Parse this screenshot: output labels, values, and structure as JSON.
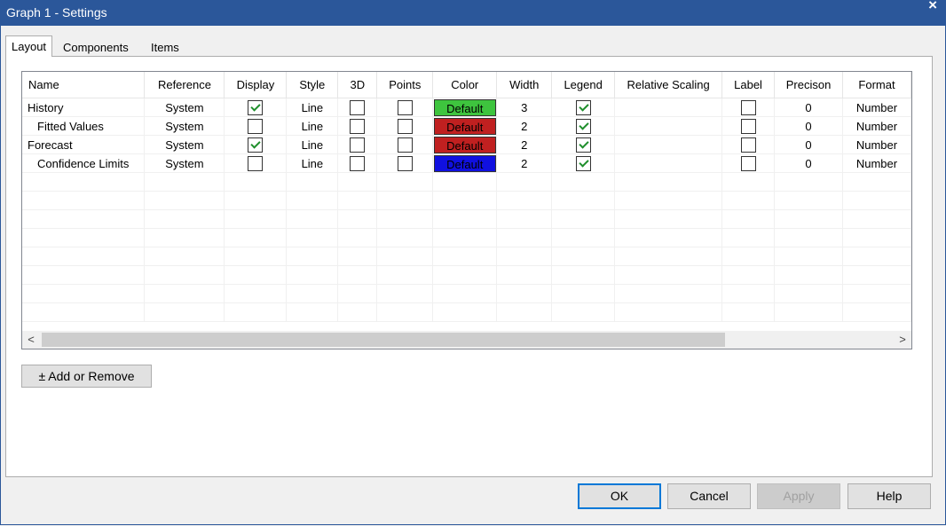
{
  "window": {
    "title": "Graph 1 - Settings",
    "close_glyph": "×"
  },
  "tabs": [
    {
      "label": "Layout",
      "active": true
    },
    {
      "label": "Components",
      "active": false
    },
    {
      "label": "Items",
      "active": false
    }
  ],
  "grid": {
    "columns": [
      "Name",
      "Reference",
      "Display",
      "Style",
      "3D",
      "Points",
      "Color",
      "Width",
      "Legend",
      "Relative Scaling",
      "Label",
      "Precison",
      "Format"
    ],
    "rows": [
      {
        "name": "History",
        "reference": "System",
        "display": true,
        "style": "Line",
        "three_d": false,
        "points": false,
        "color": {
          "label": "Default",
          "hex": "#3ec43e",
          "text": "#000000"
        },
        "width": "3",
        "legend": true,
        "relative_scaling": "",
        "label": false,
        "precision": "0",
        "format": "Number"
      },
      {
        "name": "Fitted Values",
        "indent": true,
        "reference": "System",
        "display": false,
        "style": "Line",
        "three_d": false,
        "points": false,
        "color": {
          "label": "Default",
          "hex": "#c02020",
          "text": "#000000"
        },
        "width": "2",
        "legend": true,
        "relative_scaling": "",
        "label": false,
        "precision": "0",
        "format": "Number"
      },
      {
        "name": "Forecast",
        "reference": "System",
        "display": true,
        "style": "Line",
        "three_d": false,
        "points": false,
        "color": {
          "label": "Default",
          "hex": "#c02020",
          "text": "#000000"
        },
        "width": "2",
        "legend": true,
        "relative_scaling": "",
        "label": false,
        "precision": "0",
        "format": "Number"
      },
      {
        "name": "Confidence Limits",
        "indent": true,
        "reference": "System",
        "display": false,
        "style": "Line",
        "three_d": false,
        "points": false,
        "color": {
          "label": "Default",
          "hex": "#1010e0",
          "text": "#000000"
        },
        "width": "2",
        "legend": true,
        "relative_scaling": "",
        "label": false,
        "precision": "0",
        "format": "Number"
      }
    ],
    "empty_rows": 8
  },
  "scroll": {
    "left_glyph": "<",
    "right_glyph": ">"
  },
  "buttons": {
    "add_remove": "± Add or Remove",
    "ok": "OK",
    "cancel": "Cancel",
    "apply": "Apply",
    "help": "Help"
  },
  "colors": {
    "title_bar": "#2b579a",
    "check": "#1f8f2c"
  }
}
